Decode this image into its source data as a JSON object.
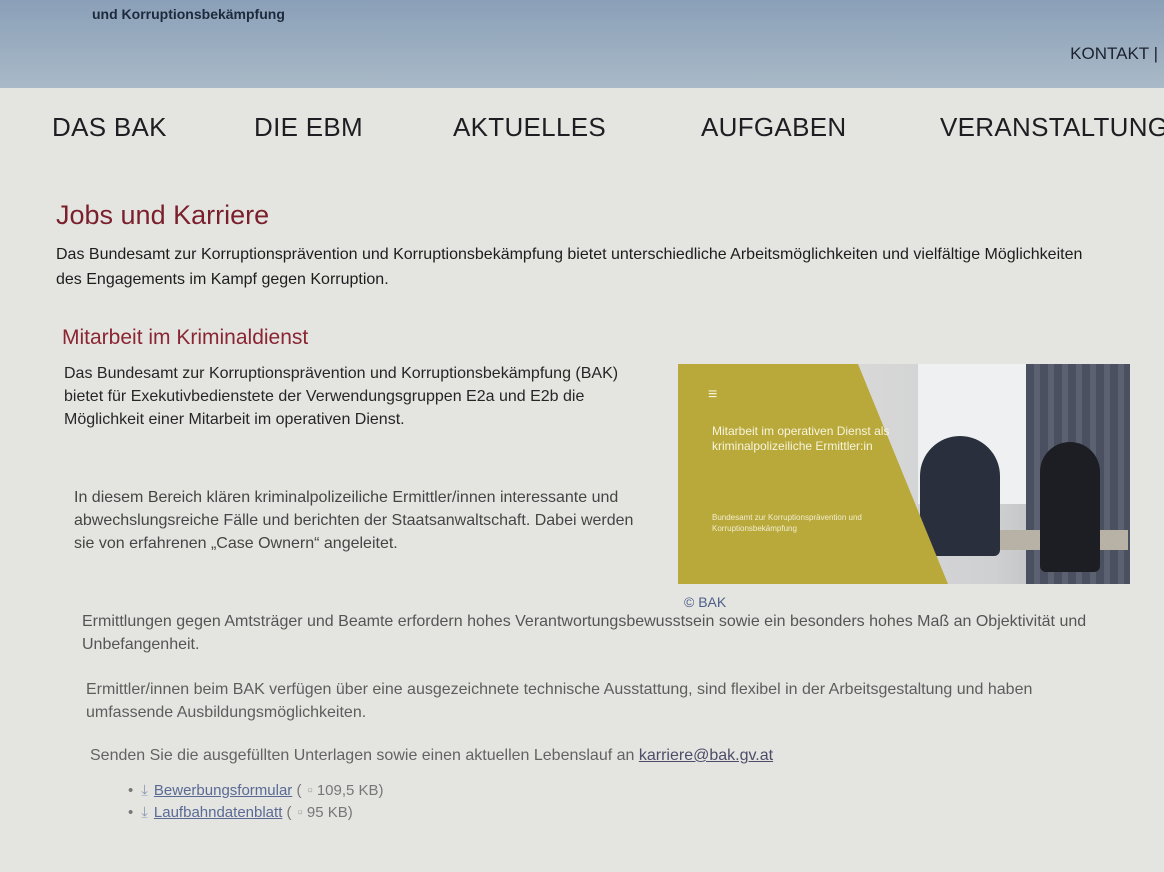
{
  "header": {
    "org_name": "und Korruptionsbekämpfung",
    "kontakt": "KONTAKT |"
  },
  "nav": {
    "items": [
      {
        "label": "DAS BAK"
      },
      {
        "label": "DIE EBM"
      },
      {
        "label": "AKTUELLES"
      },
      {
        "label": "AUFGABEN"
      },
      {
        "label": "VERANSTALTUNG"
      }
    ]
  },
  "main": {
    "title": "Jobs und Karriere",
    "intro": "Das Bundesamt zur Korruptionsprävention und Korruptionsbekämpfung bietet unterschiedliche Arbeitsmöglichkeiten und vielfältige Möglichkeiten des Engagements im Kampf gegen Korruption.",
    "section_title": "Mitarbeit im Kriminaldienst",
    "para1": "Das Bundesamt zur Korruptionsprävention und Korruptionsbekämpfung (BAK) bietet für Exekutivbedienstete der Verwendungsgruppen E2a und E2b die Möglichkeit einer Mitarbeit im operativen Dienst.",
    "para2": "In diesem Bereich klären kriminalpolizeiliche Ermittler/innen interessante und abwechslungsreiche Fälle und berichten der Staatsanwaltschaft. Dabei werden sie von erfahrenen „Case Ownern“ angeleitet.",
    "para3": "Ermittlungen gegen Amtsträger und Beamte erfordern hohes Verantwortungsbewusstsein sowie ein besonders hohes Maß an Objektivität und Unbefangenheit.",
    "para4": "Ermittler/innen beim BAK verfügen über eine ausgezeichnete technische Ausstattung, sind flexibel in der Arbeitsgestaltung und haben umfassende Ausbildungsmöglichkeiten.",
    "para5": "Senden Sie die ausgefüllten Unterlagen sowie einen aktuellen Lebenslauf an",
    "email": "karriere@bak.gv.at",
    "image": {
      "menu_icon": "≡",
      "overlay_title": "Mitarbeit im operativen Dienst als kriminalpolizeiliche Ermittler:in",
      "overlay_subtitle": "Bundesamt zur Korruptionsprävention und Korruptionsbekämpfung",
      "credit": "© BAK"
    },
    "downloads": [
      {
        "label": "Bewerbungsformular",
        "size": "109,5 KB"
      },
      {
        "label": "Laufbahndatenblatt",
        "size": "95 KB"
      }
    ]
  }
}
